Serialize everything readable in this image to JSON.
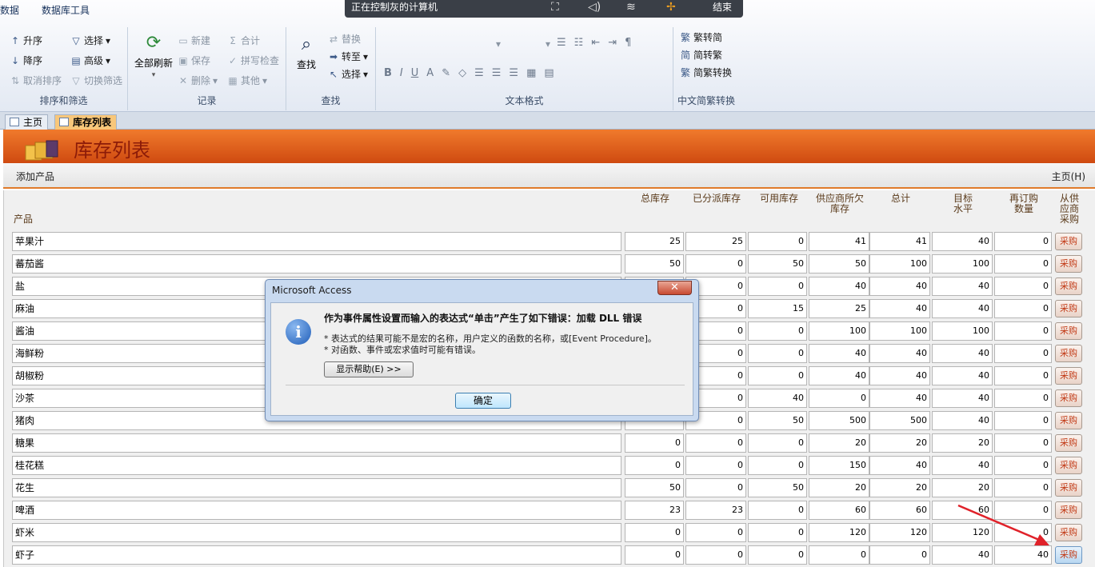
{
  "ribbon": {
    "tabs": [
      "数据",
      "数据库工具"
    ],
    "sort_filter": {
      "ascending": "升序",
      "descending": "降序",
      "clear_sort": "取消排序",
      "selection": "选择",
      "advanced": "高级",
      "toggle_filter": "切换筛选",
      "label": "排序和筛选"
    },
    "records": {
      "refresh_all": "全部刷新",
      "new": "新建",
      "save": "保存",
      "delete": "删除",
      "totals": "合计",
      "spelling": "拼写检查",
      "more": "其他",
      "label": "记录"
    },
    "find": {
      "find": "查找",
      "replace": "替换",
      "goto": "转至",
      "select": "选择",
      "label": "查找"
    },
    "text_format": {
      "label": "文本格式"
    },
    "chinese_conversion": {
      "trad_to_simp": "繁转简",
      "simp_to_trad": "简转繁",
      "convert": "简繁转换",
      "label": "中文简繁转换"
    }
  },
  "overlay": {
    "title": "正在控制灰的计算机",
    "end": "结束"
  },
  "doc_tabs": [
    {
      "label": "主页",
      "active": false
    },
    {
      "label": "库存列表",
      "active": true
    }
  ],
  "form": {
    "title": "库存列表",
    "add_product": "添加产品",
    "home": "主页(H)"
  },
  "columns": {
    "product": "产品",
    "total_stock": "总库存",
    "allocated": "已分派库存",
    "available": "可用库存",
    "owed_line1": "供应商所欠",
    "owed_line2": "库存",
    "total": "总计",
    "target_line1": "目标",
    "target_line2": "水平",
    "reorder_line1": "再订购",
    "reorder_line2": "数量",
    "purchase_line1": "从供",
    "purchase_line2": "应商",
    "purchase_line3": "采购"
  },
  "buy_label": "采购",
  "rows": [
    {
      "product": "苹果汁",
      "total_stock": "25",
      "allocated": "25",
      "available": "0",
      "owed": "41",
      "total": "41",
      "target": "40",
      "reorder": "0"
    },
    {
      "product": "蕃茄酱",
      "total_stock": "50",
      "allocated": "0",
      "available": "50",
      "owed": "50",
      "total": "100",
      "target": "100",
      "reorder": "0"
    },
    {
      "product": "盐",
      "total_stock": "",
      "allocated": "0",
      "available": "0",
      "owed": "40",
      "total": "40",
      "target": "40",
      "reorder": "0"
    },
    {
      "product": "麻油",
      "total_stock": "",
      "allocated": "0",
      "available": "15",
      "owed": "25",
      "total": "40",
      "target": "40",
      "reorder": "0"
    },
    {
      "product": "酱油",
      "total_stock": "",
      "allocated": "0",
      "available": "0",
      "owed": "100",
      "total": "100",
      "target": "100",
      "reorder": "0"
    },
    {
      "product": "海鲜粉",
      "total_stock": "",
      "allocated": "0",
      "available": "0",
      "owed": "40",
      "total": "40",
      "target": "40",
      "reorder": "0"
    },
    {
      "product": "胡椒粉",
      "total_stock": "",
      "allocated": "0",
      "available": "0",
      "owed": "40",
      "total": "40",
      "target": "40",
      "reorder": "0"
    },
    {
      "product": "沙茶",
      "total_stock": "",
      "allocated": "0",
      "available": "40",
      "owed": "0",
      "total": "40",
      "target": "40",
      "reorder": "0"
    },
    {
      "product": "猪肉",
      "total_stock": "",
      "allocated": "0",
      "available": "50",
      "owed": "500",
      "total": "500",
      "target": "40",
      "reorder": "0"
    },
    {
      "product": "糖果",
      "total_stock": "0",
      "allocated": "0",
      "available": "0",
      "owed": "20",
      "total": "20",
      "target": "20",
      "reorder": "0"
    },
    {
      "product": "桂花糕",
      "total_stock": "0",
      "allocated": "0",
      "available": "0",
      "owed": "150",
      "total": "40",
      "target": "40",
      "reorder": "0"
    },
    {
      "product": "花生",
      "total_stock": "50",
      "allocated": "0",
      "available": "50",
      "owed": "20",
      "total": "20",
      "target": "20",
      "reorder": "0"
    },
    {
      "product": "啤酒",
      "total_stock": "23",
      "allocated": "23",
      "available": "0",
      "owed": "60",
      "total": "60",
      "target": "60",
      "reorder": "0"
    },
    {
      "product": "虾米",
      "total_stock": "0",
      "allocated": "0",
      "available": "0",
      "owed": "120",
      "total": "120",
      "target": "120",
      "reorder": "0"
    },
    {
      "product": "虾子",
      "total_stock": "0",
      "allocated": "0",
      "available": "0",
      "owed": "0",
      "total": "0",
      "target": "40",
      "reorder": "40"
    }
  ],
  "dialog": {
    "title": "Microsoft Access",
    "close": "✕",
    "heading": "作为事件属性设置而输入的表达式“单击”产生了如下错误：加载 DLL 错误",
    "line1": "* 表达式的结果可能不是宏的名称，用户定义的函数的名称，或[Event Procedure]。",
    "line2": "* 对函数、事件或宏求值时可能有错误。",
    "help_button": "显示帮助(E) >>",
    "ok_button": "确定"
  },
  "colors": {
    "header_orange": "#e0601c",
    "title_red": "#8c1b08",
    "arrow_red": "#e0222a"
  }
}
